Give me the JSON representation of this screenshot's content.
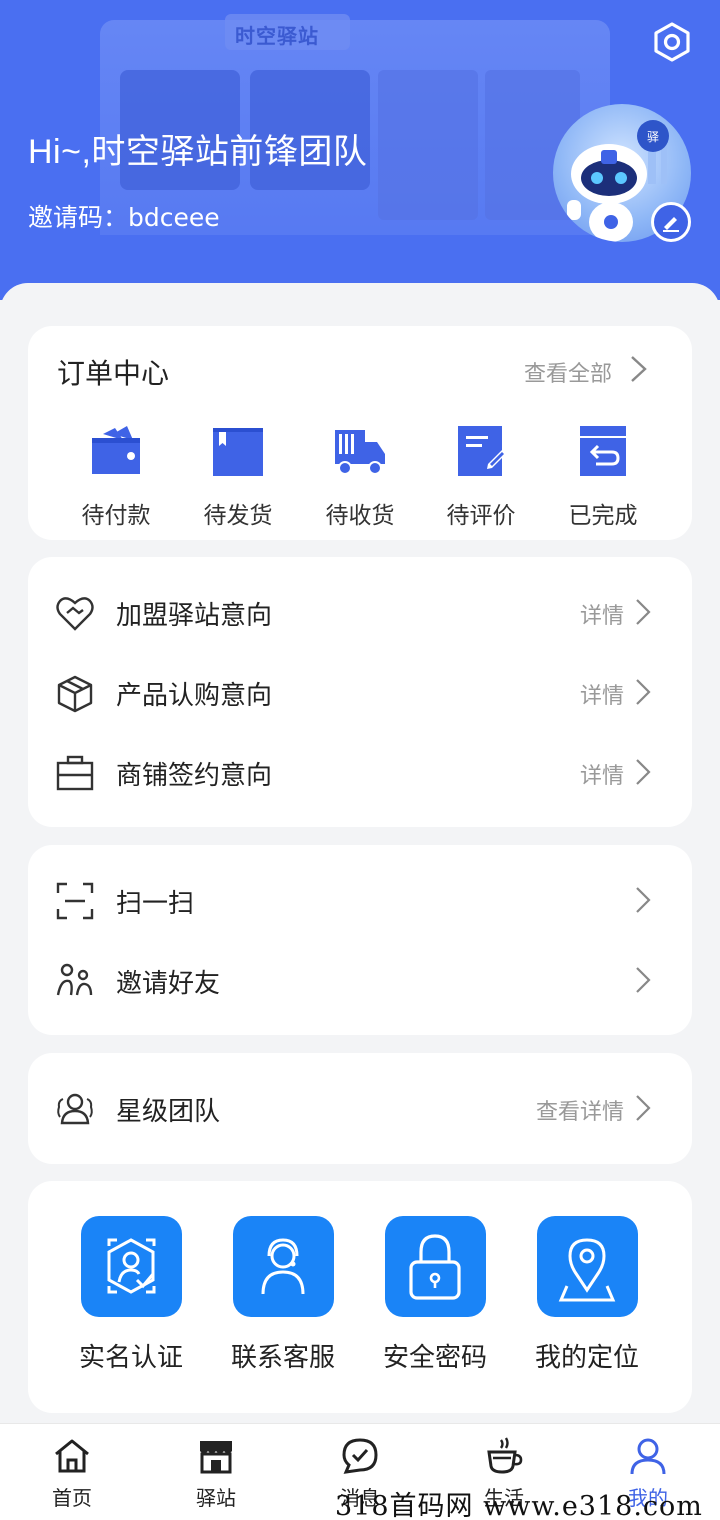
{
  "header": {
    "kiosk_sign": "时空驿站",
    "greeting": "Hi~,时空驿站前锋团队",
    "invite_label": "邀请码：",
    "invite_code": "bdceee"
  },
  "orders": {
    "title": "订单中心",
    "view_all": "查看全部",
    "items": [
      {
        "label": "待付款",
        "icon": "wallet-icon"
      },
      {
        "label": "待发货",
        "icon": "box-icon"
      },
      {
        "label": "待收货",
        "icon": "truck-icon"
      },
      {
        "label": "待评价",
        "icon": "review-icon"
      },
      {
        "label": "已完成",
        "icon": "return-box-icon"
      }
    ]
  },
  "intents": {
    "items": [
      {
        "label": "加盟驿站意向",
        "detail": "详情",
        "icon": "handshake-heart-icon"
      },
      {
        "label": "产品认购意向",
        "detail": "详情",
        "icon": "package-icon"
      },
      {
        "label": "商铺签约意向",
        "detail": "详情",
        "icon": "briefcase-icon"
      }
    ]
  },
  "actions": {
    "items": [
      {
        "label": "扫一扫",
        "icon": "scan-icon"
      },
      {
        "label": "邀请好友",
        "icon": "invite-friends-icon"
      }
    ]
  },
  "team": {
    "label": "星级团队",
    "detail": "查看详情",
    "icon": "team-icon"
  },
  "tools": {
    "items": [
      {
        "label": "实名认证",
        "icon": "id-verify-icon"
      },
      {
        "label": "联系客服",
        "icon": "customer-service-icon"
      },
      {
        "label": "安全密码",
        "icon": "lock-icon"
      },
      {
        "label": "我的定位",
        "icon": "location-icon"
      }
    ]
  },
  "nav": {
    "items": [
      {
        "label": "首页",
        "icon": "home-icon",
        "active": false
      },
      {
        "label": "驿站",
        "icon": "store-icon",
        "active": false
      },
      {
        "label": "消息",
        "icon": "message-icon",
        "active": false
      },
      {
        "label": "生活",
        "icon": "coffee-icon",
        "active": false
      },
      {
        "label": "我的",
        "icon": "profile-icon",
        "active": true
      }
    ]
  },
  "colors": {
    "header_blue": "#4a6ff1",
    "icon_blue": "#3f63e6",
    "tool_blue": "#1a84f7",
    "active_nav": "#3f63e6"
  },
  "watermark": "318首码网 www.e318.com"
}
